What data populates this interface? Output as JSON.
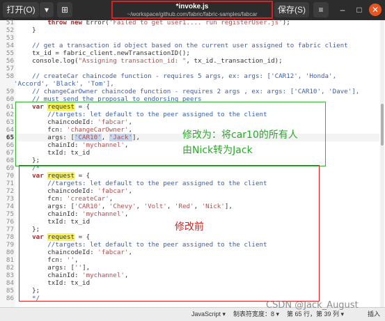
{
  "header": {
    "open_label": "打开(O)",
    "dropdown_icon": "▾",
    "newtab_icon": "⊞",
    "title": "*invoke.js",
    "path": "~/workspace/github.com/fabric/fabric-samples/fabcar",
    "save_label": "保存(S)",
    "menu_icon": "≡",
    "minimize_icon": "–",
    "maximize_icon": "□",
    "close_icon": "✕"
  },
  "annotations": {
    "green_line1": "修改为：将car10的所有人",
    "green_line2": "由Nick转为Jack",
    "red": "修改前"
  },
  "status": {
    "language": "JavaScript ▾",
    "tab_width": "制表符宽度：8 ▾",
    "position": "第 65 行，第 39 列 ▾",
    "insert": "插入"
  },
  "watermark": "CSDN @Jack_August",
  "colors": {
    "green_box": "#2fb52f",
    "red_box": "#e02020",
    "highlight": "#f7f35a"
  }
}
